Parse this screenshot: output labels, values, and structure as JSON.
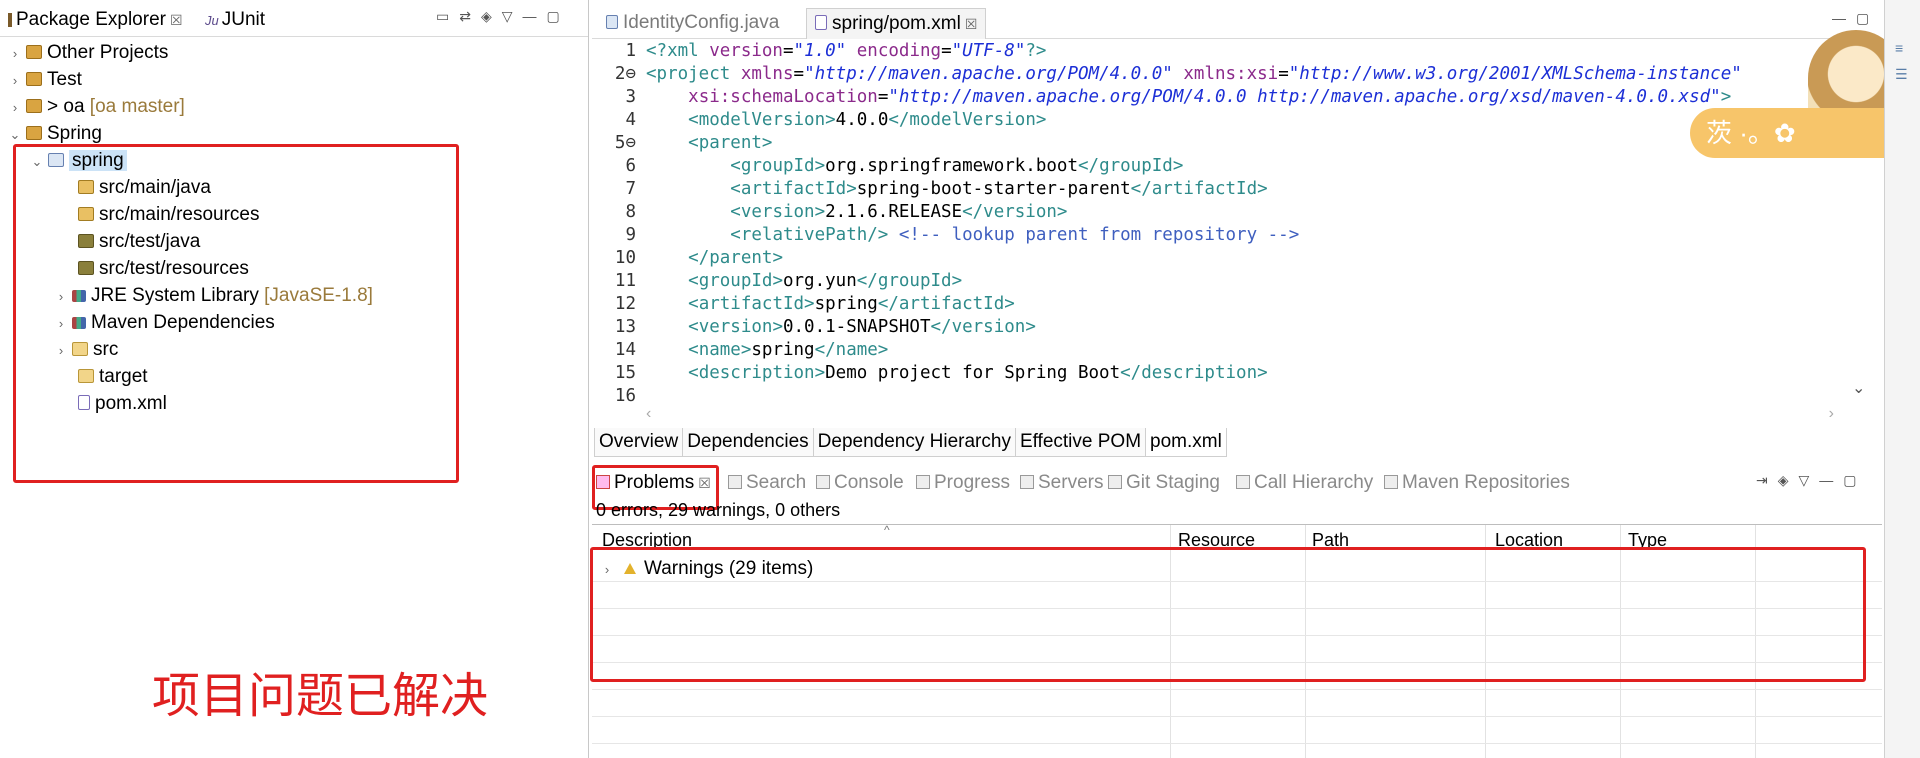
{
  "left_panel": {
    "tabs": [
      {
        "label": "Package Explorer",
        "close": "☒"
      },
      {
        "label": "JUnit"
      }
    ],
    "tree": [
      {
        "label": "Other Projects",
        "level": 0,
        "expanded": false
      },
      {
        "label": "Test",
        "level": 0,
        "expanded": false
      },
      {
        "label": "> oa",
        "decoration": "[oa master]",
        "level": 0,
        "expanded": false
      },
      {
        "label": "Spring",
        "level": 0,
        "expanded": true
      },
      {
        "label": "spring",
        "level": 1,
        "expanded": true,
        "selected": true
      },
      {
        "label": "src/main/java",
        "level": 2
      },
      {
        "label": "src/main/resources",
        "level": 2
      },
      {
        "label": "src/test/java",
        "level": 2
      },
      {
        "label": "src/test/resources",
        "level": 2
      },
      {
        "label": "JRE System Library",
        "decoration": "[JavaSE-1.8]",
        "level": 2,
        "expanded": false
      },
      {
        "label": "Maven Dependencies",
        "level": 2,
        "expanded": false
      },
      {
        "label": "src",
        "level": 2,
        "expanded": false
      },
      {
        "label": "target",
        "level": 2
      },
      {
        "label": "pom.xml",
        "level": 2
      }
    ],
    "annotation": "项目问题已解决"
  },
  "editor": {
    "tabs": [
      {
        "label": "IdentityConfig.java",
        "active": false
      },
      {
        "label": "spring/pom.xml",
        "active": true,
        "close": "☒"
      }
    ],
    "line_numbers": [
      "1",
      "2⊖",
      "3",
      "4",
      "5⊖",
      "6",
      "7",
      "8",
      "9",
      "10",
      "11",
      "12",
      "13",
      "14",
      "15",
      "16"
    ],
    "bottom_tabs": [
      "Overview",
      "Dependencies",
      "Dependency Hierarchy",
      "Effective POM",
      "pom.xml"
    ],
    "badge_text": "茨 ·。✿"
  },
  "problems": {
    "tabs": [
      {
        "label": "Problems",
        "active": true,
        "close": "☒"
      },
      {
        "label": "Search"
      },
      {
        "label": "Console"
      },
      {
        "label": "Progress"
      },
      {
        "label": "Servers"
      },
      {
        "label": "Git Staging"
      },
      {
        "label": "Call Hierarchy"
      },
      {
        "label": "Maven Repositories"
      }
    ],
    "summary": "0 errors, 29 warnings, 0 others",
    "columns": [
      "Description",
      "Resource",
      "Path",
      "Location",
      "Type"
    ],
    "rows": [
      {
        "description": "Warnings (29 items)"
      }
    ]
  },
  "colors": {
    "annotation_red": "#e02020",
    "xml_tag": "#2e8b8b",
    "xml_attr": "#8b2a8b",
    "xml_string": "#1c2fd6",
    "xml_comment": "#3f5fbf",
    "selection": "#cce3f7"
  },
  "icons": {
    "chevron_right": "›",
    "chevron_down": "⌄",
    "warning": "warning-triangle-icon"
  }
}
